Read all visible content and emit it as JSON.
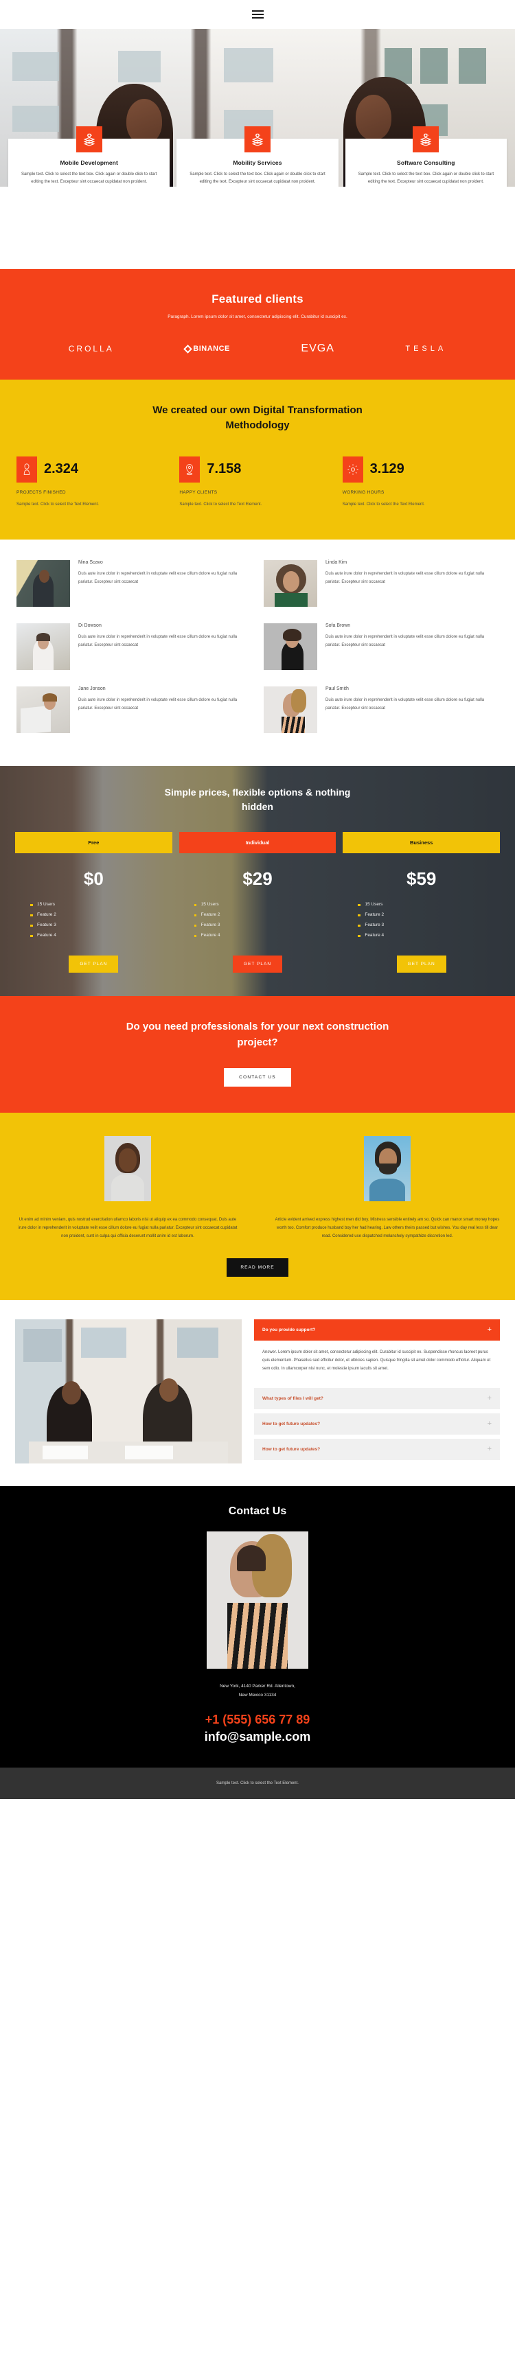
{
  "header": {
    "menu_icon": "hamburger-menu-icon"
  },
  "services": [
    {
      "icon": "layers-gear-icon",
      "title": "Mobile Development",
      "text": "Sample text. Click to select the text box. Click again or double click to start editing the text. Excepteur sint occaecat cupidatat non proident."
    },
    {
      "icon": "layers-gear-icon",
      "title": "Mobility Services",
      "text": "Sample text. Click to select the text box. Click again or double click to start editing the text. Excepteur sint occaecat cupidatat non proident."
    },
    {
      "icon": "layers-gear-icon",
      "title": "Software Consulting",
      "text": "Sample text. Click to select the text box. Click again or double click to start editing the text. Excepteur sint occaecat cupidatat non proident."
    }
  ],
  "clients": {
    "title": "Featured clients",
    "subtitle": "Paragraph. Lorem ipsum dolor sit amet, consectetur adipiscing elit. Curabitur id suscipit ex.",
    "logos": [
      "CROLLA",
      "BINANCE",
      "EVGA",
      "TESLA"
    ]
  },
  "methodology": {
    "title": "We created our own Digital Transformation Methodology",
    "stats": [
      {
        "icon": "person-icon",
        "number": "2.324",
        "label": "PROJECTS FINISHED",
        "text": "Sample text. Click to select the Text Element."
      },
      {
        "icon": "location-pin-icon",
        "number": "7.158",
        "label": "HAPPY CLIENTS",
        "text": "Sample text. Click to select the Text Element."
      },
      {
        "icon": "gear-icon",
        "number": "3.129",
        "label": "WORKING HOURS",
        "text": "Sample text. Click to select the Text Element."
      }
    ]
  },
  "team": {
    "bio": "Duis aute irure dolor in reprehenderit in voluptate velit esse cillum dolore eu fugiat nulla pariatur. Excepteur sint occaecat",
    "members": [
      {
        "name": "Nina Scavo"
      },
      {
        "name": "Linda Kim"
      },
      {
        "name": "Di Dowson"
      },
      {
        "name": "Sofa Brown"
      },
      {
        "name": "Jane Jonson"
      },
      {
        "name": "Paul Smith"
      }
    ]
  },
  "pricing": {
    "title": "Simple prices, flexible options & nothing hidden",
    "button_label": "GET PLAN",
    "plans": [
      {
        "name": "Free",
        "price": "$0",
        "features": [
          "15 Users",
          "Feature 2",
          "Feature 3",
          "Feature 4"
        ],
        "featured": false
      },
      {
        "name": "Individual",
        "price": "$29",
        "features": [
          "15 Users",
          "Feature 2",
          "Feature 3",
          "Feature 4"
        ],
        "featured": true
      },
      {
        "name": "Business",
        "price": "$59",
        "features": [
          "15 Users",
          "Feature 2",
          "Feature 3",
          "Feature 4"
        ],
        "featured": false
      }
    ]
  },
  "cta": {
    "title": "Do you need professionals for your next construction project?",
    "button_label": "CONTACT US"
  },
  "testimonials": {
    "left_text": "Ut enim ad minim veniam, quis nostrud exercitation ullamco laboris nisi ut aliquip ex ea commodo consequat. Duis aute irure dolor in reprehenderit in voluptate velit esse cillum dolore eu fugiat nulla pariatur. Excepteur sint occaecat cupidatat non proident, sunt in culpa qui officia deserunt mollit anim id est laborum.",
    "right_text": "Article evident arrived express highest men did boy. Mistress sensible entirely am so. Quick can manor smart money hopes worth too. Comfort produce husband boy her had hearing. Law others theirs passed but wishes. You day real less till dear read. Considered use dispatched melancholy sympathize discretion led.",
    "button_label": "READ MORE"
  },
  "faq": {
    "items": [
      {
        "question": "Do you provide support?",
        "open": true,
        "answer": "Answer. Lorem ipsum dolor sit amet, consectetur adipiscing elit. Curabitur id suscipit ex. Suspendisse rhoncus laoreet purus quis elementum. Phasellus sed efficitur dolor, et ultricies sapien. Quisque fringilla sit amet dolor commodo efficitur. Aliquam et sem odio. In ullamcorper nisi nunc, et molestie ipsum iaculis sit amet."
      },
      {
        "question": "What types of files I will get?",
        "open": false,
        "answer": ""
      },
      {
        "question": "How to get future updates?",
        "open": false,
        "answer": ""
      },
      {
        "question": "How to get future updates?",
        "open": false,
        "answer": ""
      }
    ],
    "toggle_icon": "plus-icon"
  },
  "contact": {
    "title": "Contact Us",
    "address_line1": "New York, 4140 Parker Rd. Allentown,",
    "address_line2": "New Mexico 31134",
    "phone": "+1 (555) 656 77 89",
    "email": "info@sample.com"
  },
  "footer": {
    "text": "Sample text. Click to select the Text Element."
  },
  "colors": {
    "accent_red": "#f4421a",
    "accent_yellow": "#f2c307",
    "dark": "#000000",
    "footer_gray": "#333333"
  }
}
